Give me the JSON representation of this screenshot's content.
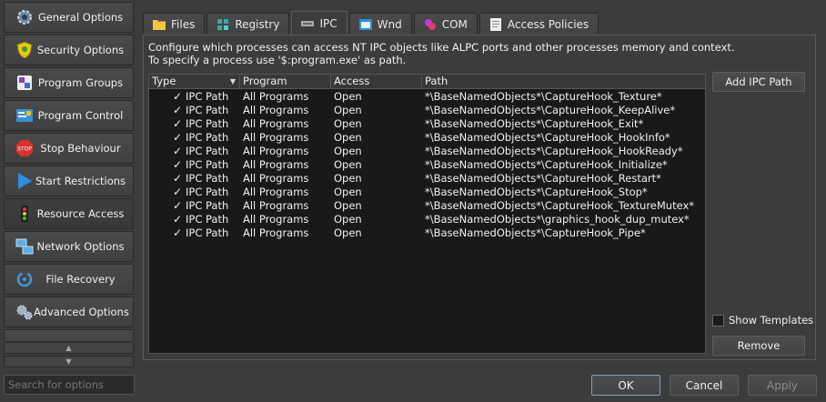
{
  "sidebar": {
    "items": [
      {
        "label": "General Options",
        "icon": "gear-icon"
      },
      {
        "label": "Security Options",
        "icon": "shield-icon"
      },
      {
        "label": "Program Groups",
        "icon": "program-groups-icon"
      },
      {
        "label": "Program Control",
        "icon": "program-control-icon"
      },
      {
        "label": "Stop Behaviour",
        "icon": "stop-icon"
      },
      {
        "label": "Start Restrictions",
        "icon": "play-icon"
      },
      {
        "label": "Resource Access",
        "icon": "traffic-light-icon"
      },
      {
        "label": "Network Options",
        "icon": "network-icon"
      },
      {
        "label": "File Recovery",
        "icon": "recovery-icon"
      },
      {
        "label": "Advanced Options",
        "icon": "advanced-gears-icon"
      }
    ],
    "search_placeholder": "Search for options"
  },
  "tabs": [
    {
      "label": "Files",
      "icon": "folder-icon"
    },
    {
      "label": "Registry",
      "icon": "registry-icon"
    },
    {
      "label": "IPC",
      "icon": "ipc-icon"
    },
    {
      "label": "Wnd",
      "icon": "window-icon"
    },
    {
      "label": "COM",
      "icon": "com-icon"
    },
    {
      "label": "Access Policies",
      "icon": "document-icon"
    }
  ],
  "active_tab": "IPC",
  "description": {
    "line1": "Configure which processes can access NT IPC objects like ALPC ports and other processes memory and context.",
    "line2": "To specify a process use '$:program.exe' as path."
  },
  "table": {
    "columns": [
      "Type",
      "Program",
      "Access",
      "Path"
    ],
    "rows": [
      {
        "type": "IPC Path",
        "program": "All Programs",
        "access": "Open",
        "path": "*\\BaseNamedObjects*\\CaptureHook_Texture*"
      },
      {
        "type": "IPC Path",
        "program": "All Programs",
        "access": "Open",
        "path": "*\\BaseNamedObjects*\\CaptureHook_KeepAlive*"
      },
      {
        "type": "IPC Path",
        "program": "All Programs",
        "access": "Open",
        "path": "*\\BaseNamedObjects*\\CaptureHook_Exit*"
      },
      {
        "type": "IPC Path",
        "program": "All Programs",
        "access": "Open",
        "path": "*\\BaseNamedObjects*\\CaptureHook_HookInfo*"
      },
      {
        "type": "IPC Path",
        "program": "All Programs",
        "access": "Open",
        "path": "*\\BaseNamedObjects*\\CaptureHook_HookReady*"
      },
      {
        "type": "IPC Path",
        "program": "All Programs",
        "access": "Open",
        "path": "*\\BaseNamedObjects*\\CaptureHook_Initialize*"
      },
      {
        "type": "IPC Path",
        "program": "All Programs",
        "access": "Open",
        "path": "*\\BaseNamedObjects*\\CaptureHook_Restart*"
      },
      {
        "type": "IPC Path",
        "program": "All Programs",
        "access": "Open",
        "path": "*\\BaseNamedObjects*\\CaptureHook_Stop*"
      },
      {
        "type": "IPC Path",
        "program": "All Programs",
        "access": "Open",
        "path": "*\\BaseNamedObjects*\\CaptureHook_TextureMutex*"
      },
      {
        "type": "IPC Path",
        "program": "All Programs",
        "access": "Open",
        "path": "*\\BaseNamedObjects*\\graphics_hook_dup_mutex*"
      },
      {
        "type": "IPC Path",
        "program": "All Programs",
        "access": "Open",
        "path": "*\\BaseNamedObjects*\\CaptureHook_Pipe*"
      }
    ],
    "checked_glyph": "✓"
  },
  "buttons": {
    "add_ipc_path": "Add IPC Path",
    "show_templates": "Show Templates",
    "remove": "Remove",
    "ok": "OK",
    "cancel": "Cancel",
    "apply": "Apply"
  },
  "colors": {
    "accent_border": "#7da2c8",
    "stop_red": "#d9332b",
    "shield_yellow": "#e6c619"
  }
}
